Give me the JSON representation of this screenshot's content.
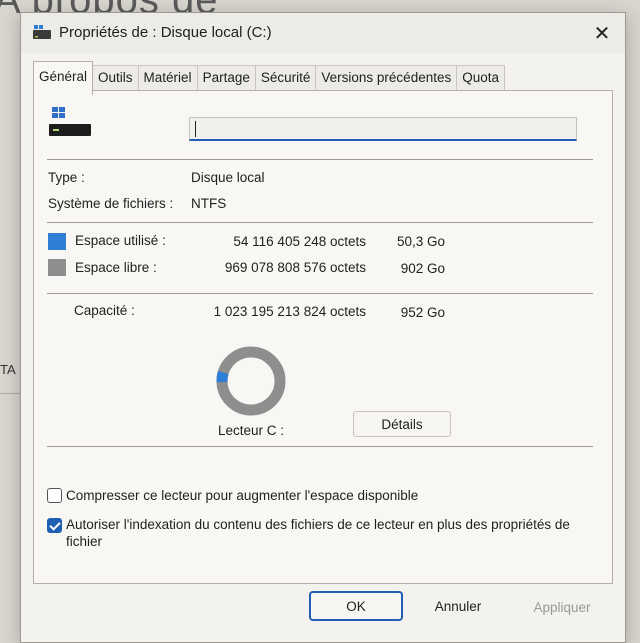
{
  "background": {
    "title_fragment": "A propos de",
    "side_text": "TA"
  },
  "window": {
    "title": "Propriétés de : Disque local (C:)",
    "close_glyph": "✕"
  },
  "tabs": [
    {
      "label": "Général",
      "active": true
    },
    {
      "label": "Outils",
      "active": false
    },
    {
      "label": "Matériel",
      "active": false
    },
    {
      "label": "Partage",
      "active": false
    },
    {
      "label": "Sécurité",
      "active": false
    },
    {
      "label": "Versions précédentes",
      "active": false
    },
    {
      "label": "Quota",
      "active": false
    }
  ],
  "general": {
    "drive_name_value": "",
    "type_label": "Type :",
    "type_value": "Disque local",
    "fs_label": "Système de fichiers :",
    "fs_value": "NTFS",
    "used": {
      "label": "Espace utilisé :",
      "bytes": "54 116 405 248 octets",
      "size": "50,3 Go",
      "color": "#2f7fd6"
    },
    "free": {
      "label": "Espace libre :",
      "bytes": "969 078 808 576 octets",
      "size": "902 Go",
      "color": "#8e8e8e"
    },
    "capacity": {
      "label": "Capacité :",
      "bytes": "1 023 195 213 824 octets",
      "size": "952 Go"
    },
    "used_fraction": 0.053,
    "drive_label": "Lecteur C :",
    "details_button": "Détails",
    "compress_label": "Compresser ce lecteur pour augmenter l'espace disponible",
    "compress_checked": false,
    "index_label": "Autoriser l'indexation du contenu des fichiers de ce lecteur en plus des propriétés de fichier",
    "index_checked": true
  },
  "buttons": {
    "ok": "OK",
    "cancel": "Annuler",
    "apply": "Appliquer"
  }
}
